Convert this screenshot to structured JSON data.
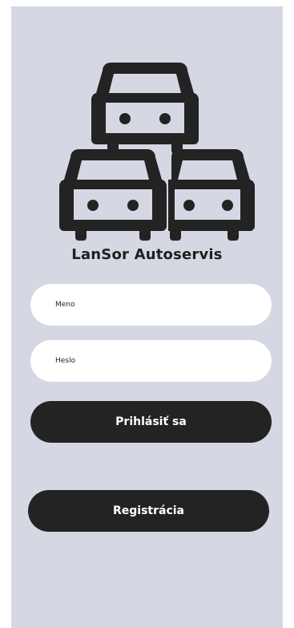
{
  "app": {
    "title": "LanSor Autoservis"
  },
  "form": {
    "username_placeholder": "Meno",
    "password_placeholder": "Heslo",
    "login_label": "Prihlásiť sa",
    "register_label": "Registrácia"
  },
  "logo": {
    "icon": "three-cars-icon",
    "color": "#232323"
  },
  "colors": {
    "background": "#d5d7e3",
    "button": "#232323",
    "field": "#ffffff"
  }
}
